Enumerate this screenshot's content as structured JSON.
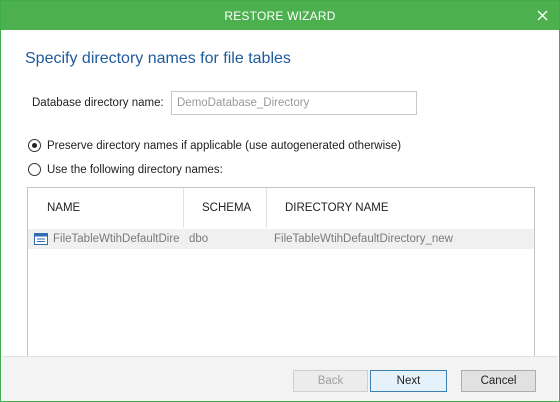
{
  "window": {
    "title": "RESTORE WIZARD"
  },
  "page": {
    "title": "Specify directory names for file tables"
  },
  "database_directory": {
    "label": "Database directory name:",
    "value": "DemoDatabase_Directory"
  },
  "options": {
    "preserve_label": "Preserve directory names if applicable (use autogenerated otherwise)",
    "preserve_selected": true,
    "custom_label": "Use the following directory names:",
    "custom_selected": false
  },
  "grid": {
    "columns": [
      "NAME",
      "SCHEMA",
      "DIRECTORY NAME"
    ],
    "rows": [
      {
        "name": "FileTableWtihDefaultDire",
        "schema": "dbo",
        "directory": "FileTableWtihDefaultDirectory_new",
        "icon": "table-icon"
      }
    ]
  },
  "buttons": {
    "back": "Back",
    "next": "Next",
    "cancel": "Cancel"
  },
  "colors": {
    "titlebar": "#4cb04f",
    "title_text": "#1f5a9b"
  }
}
